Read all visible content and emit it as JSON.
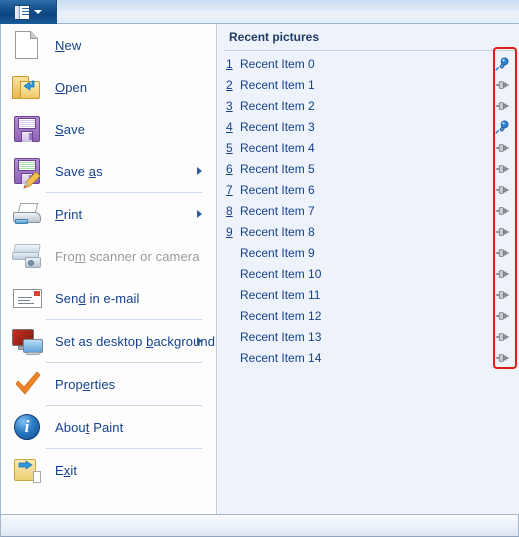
{
  "window": {
    "file_tab_icon": "file-menu-icon",
    "file_tab_arrow": "chevron-down-icon"
  },
  "menu": {
    "items": [
      {
        "label_pre": "",
        "accel": "N",
        "label_post": "ew",
        "icon": "new-document-icon",
        "submenu": false,
        "disabled": false,
        "separator_after": false,
        "name": "new"
      },
      {
        "label_pre": "",
        "accel": "O",
        "label_post": "pen",
        "icon": "open-folder-icon",
        "submenu": false,
        "disabled": false,
        "separator_after": false,
        "name": "open"
      },
      {
        "label_pre": "",
        "accel": "S",
        "label_post": "ave",
        "icon": "save-floppy-icon",
        "submenu": false,
        "disabled": false,
        "separator_after": false,
        "name": "save"
      },
      {
        "label_pre": "Save ",
        "accel": "a",
        "label_post": "s",
        "icon": "save-as-floppy-icon",
        "submenu": true,
        "disabled": false,
        "separator_after": true,
        "name": "save-as"
      },
      {
        "label_pre": "",
        "accel": "P",
        "label_post": "rint",
        "icon": "printer-icon",
        "submenu": true,
        "disabled": false,
        "separator_after": false,
        "name": "print"
      },
      {
        "label_pre": "Fro",
        "accel": "m",
        "label_post": " scanner or camera",
        "icon": "scanner-camera-icon",
        "submenu": false,
        "disabled": true,
        "separator_after": false,
        "name": "from-scanner-or-camera"
      },
      {
        "label_pre": "Sen",
        "accel": "d",
        "label_post": " in e-mail",
        "icon": "email-envelope-icon",
        "submenu": false,
        "disabled": false,
        "separator_after": true,
        "name": "send-in-email"
      },
      {
        "label_pre": "Set as desktop ",
        "accel": "b",
        "label_post": "ackground",
        "icon": "desktop-background-icon",
        "submenu": true,
        "disabled": false,
        "separator_after": true,
        "name": "set-as-desktop-background"
      },
      {
        "label_pre": "Prop",
        "accel": "e",
        "label_post": "rties",
        "icon": "properties-checkmark-icon",
        "submenu": false,
        "disabled": false,
        "separator_after": true,
        "name": "properties"
      },
      {
        "label_pre": "Abou",
        "accel": "t",
        "label_post": " Paint",
        "icon": "about-info-icon",
        "submenu": false,
        "disabled": false,
        "separator_after": true,
        "name": "about-paint"
      },
      {
        "label_pre": "E",
        "accel": "x",
        "label_post": "it",
        "icon": "exit-icon",
        "submenu": false,
        "disabled": false,
        "separator_after": false,
        "name": "exit"
      }
    ]
  },
  "recent": {
    "title": "Recent pictures",
    "items": [
      {
        "number": "1",
        "name": "Recent Item 0",
        "pinned": true
      },
      {
        "number": "2",
        "name": "Recent Item 1",
        "pinned": false
      },
      {
        "number": "3",
        "name": "Recent Item 2",
        "pinned": false
      },
      {
        "number": "4",
        "name": "Recent Item 3",
        "pinned": true
      },
      {
        "number": "5",
        "name": "Recent Item 4",
        "pinned": false
      },
      {
        "number": "6",
        "name": "Recent Item 5",
        "pinned": false
      },
      {
        "number": "7",
        "name": "Recent Item 6",
        "pinned": false
      },
      {
        "number": "8",
        "name": "Recent Item 7",
        "pinned": false
      },
      {
        "number": "9",
        "name": "Recent Item 8",
        "pinned": false
      },
      {
        "number": "",
        "name": "Recent Item 9",
        "pinned": false
      },
      {
        "number": "",
        "name": "Recent Item 10",
        "pinned": false
      },
      {
        "number": "",
        "name": "Recent Item 11",
        "pinned": false
      },
      {
        "number": "",
        "name": "Recent Item 12",
        "pinned": false
      },
      {
        "number": "",
        "name": "Recent Item 13",
        "pinned": false
      },
      {
        "number": "",
        "name": "Recent Item 14",
        "pinned": false
      }
    ]
  },
  "annotation": {
    "name": "pin-column-highlight",
    "color": "#e01b1b"
  },
  "colors": {
    "accent_blue": "#15428b",
    "tab_blue": "#17528e",
    "right_pane_bg": "#eef2fa",
    "left_pane_bg": "#fdfdfd",
    "pinned_pin": "#2b82d0",
    "unpinned_pin": "#8f9499"
  }
}
